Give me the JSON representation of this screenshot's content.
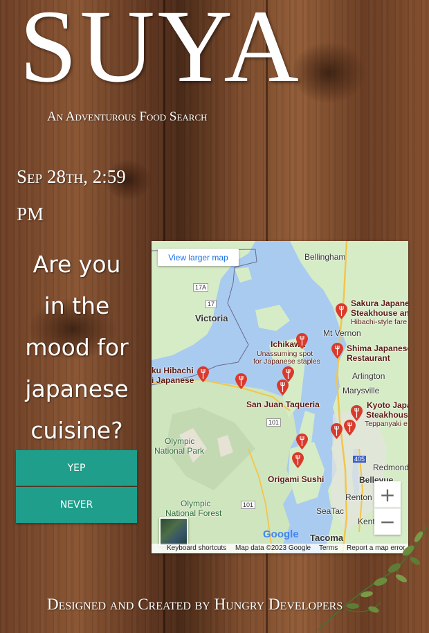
{
  "app": {
    "title": "SUYA",
    "subtitle": "An Adventurous Food Search"
  },
  "datetime": "Sep 28th, 2:59 PM",
  "prompt": {
    "question": "Are you in the mood for japanese cuisine?"
  },
  "buttons": {
    "yes_label": "YEP",
    "no_label": "NEVER"
  },
  "map": {
    "view_larger_label": "View larger map",
    "zoom_in_label": "+",
    "zoom_out_label": "−",
    "google_logo": "Google",
    "attribution": {
      "shortcuts": "Keyboard shortcuts",
      "data": "Map data ©2023 Google",
      "terms": "Terms",
      "report": "Report a map error"
    },
    "places": {
      "bellingham": "Bellingham",
      "victoria": "Victoria",
      "mt_vernon": "Mt Vernon",
      "ichikawa": "Ichikawa",
      "ichikawa_note_1": "Unassuming spot",
      "ichikawa_note_2": "for Japanese staples",
      "arlington": "Arlington",
      "marysville": "Marysville",
      "san_juan_taqueria": "San Juan Taqueria",
      "olympic_np_1": "Olympic",
      "olympic_np_2": "National Park",
      "olympic_nf_1": "Olympic",
      "olympic_nf_2": "National Forest",
      "origami_sushi": "Origami Sushi",
      "redmond": "Redmond",
      "bellevue": "Bellevue",
      "renton": "Renton",
      "seatac": "SeaTac",
      "kent": "Kent",
      "tacoma": "Tacoma",
      "sakura_1": "Sakura Japane",
      "sakura_2": "Steakhouse an",
      "sakura_3": "Hibachi-style fare",
      "shima_1": "Shima Japanese",
      "shima_2": "Restaurant",
      "kyoto_1": "Kyoto Japa",
      "kyoto_2": "Steakhous",
      "kyoto_3": "Teppanyaki e",
      "hibachi_1": "ku Hibachi",
      "hibachi_2": "i Japanese",
      "road_17a": "17A",
      "road_17": "17",
      "road_101a": "101",
      "road_101b": "101",
      "road_405": "405"
    }
  },
  "footer": "Designed and Created by Hungry Developers",
  "colors": {
    "button": "#1f9e8b",
    "pin": "#d93a2c",
    "water": "#a9cbf0",
    "land": "#d6ecc6"
  }
}
